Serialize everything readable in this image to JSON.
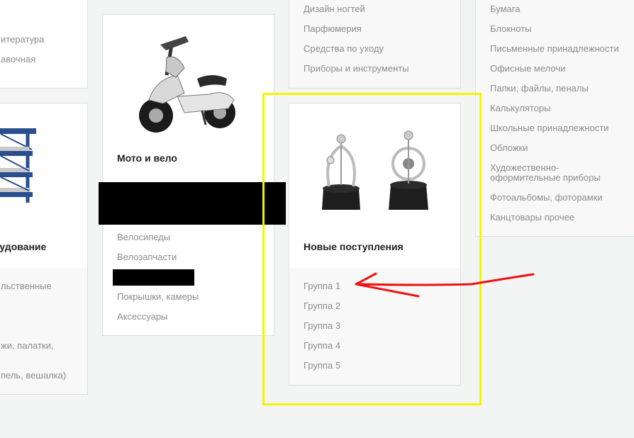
{
  "left_top_card": {
    "items": [
      "итература",
      "авочная"
    ]
  },
  "left_bottom_card": {
    "title": "рудование",
    "items": [
      "льственные",
      "жи, палатки,",
      "пель, вешалка)"
    ],
    "icon": "shelving-rack-image"
  },
  "moto_card": {
    "title": "Мото и вело",
    "icon": "scooter-image",
    "items": [
      "Велосипеды",
      "Велозапчасти",
      "Покрышки, камеры",
      "Аксессуары"
    ]
  },
  "beauty_card": {
    "items": [
      "Дизайн ногтей",
      "Парфюмерия",
      "Средства по уходу",
      "Приборы и инструменты"
    ]
  },
  "new_arrivals_card": {
    "title": "Новые поступления",
    "icon": "desk-pendulum-image",
    "items": [
      "Группа 1",
      "Группа 2",
      "Группа 3",
      "Группа 4",
      "Группа 5"
    ]
  },
  "stationery_card": {
    "items": [
      "Бумага",
      "Блокноты",
      "Письменные принадлежности",
      "Офисные мелочи",
      "Папки, файлы, пеналы",
      "Калькуляторы",
      "Школьные принадлежности",
      "Обложки",
      "Художественно-",
      "оформительные приборы",
      "Фотоальбомы, фоторамки",
      "Канцтовары прочее"
    ]
  },
  "annotations": {
    "highlight_color": "#f5f500",
    "arrow_color": "#ee1111"
  }
}
